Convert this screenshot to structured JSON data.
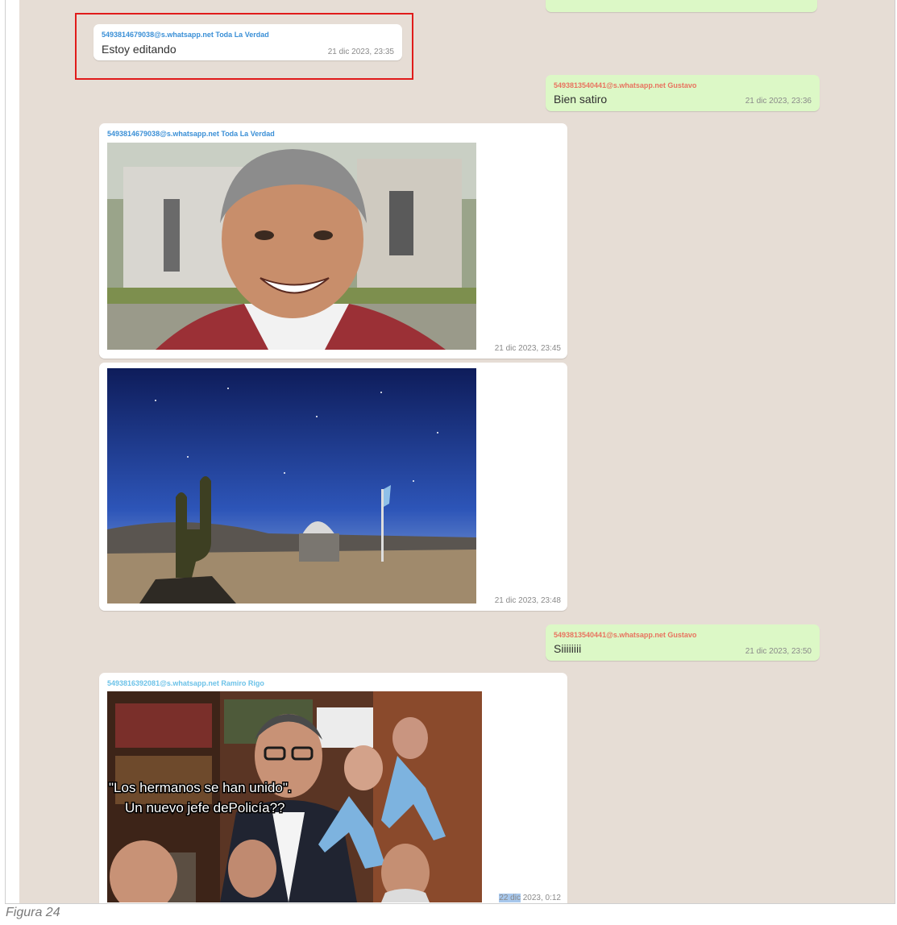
{
  "messages": [
    {
      "sender": "5493814679038@s.whatsapp.net Toda La Verdad",
      "text": "Estoy editando",
      "time": "21 dic 2023, 23:35"
    },
    {
      "sender": "5493813540441@s.whatsapp.net Gustavo",
      "text": "Bien satiro",
      "time": "21 dic 2023, 23:36"
    },
    {
      "sender": "5493814679038@s.whatsapp.net Toda La Verdad",
      "time": "21 dic 2023, 23:45"
    },
    {
      "time": "21 dic 2023, 23:48"
    },
    {
      "sender": "5493813540441@s.whatsapp.net Gustavo",
      "text": "Siiiiiiii",
      "time": "21 dic 2023, 23:50"
    },
    {
      "sender": "5493816392081@s.whatsapp.net Ramiro Rigo",
      "time_selected": "22 dic",
      "time_rest": " 2023, 0:12",
      "meme_line1": "\"Los hermanos se han unido\".",
      "meme_line2": "Un nuevo jefe dePolicía??"
    }
  ],
  "figure_caption": "Figura 24",
  "colors": {
    "background": "#e6ddd5",
    "incoming": "#ffffff",
    "outgoing": "#dcf8c6",
    "sender_blue": "#3a8fd6",
    "sender_red": "#e8735f",
    "sender_light_blue": "#6cc2e8",
    "highlight": "#e01b1b"
  }
}
